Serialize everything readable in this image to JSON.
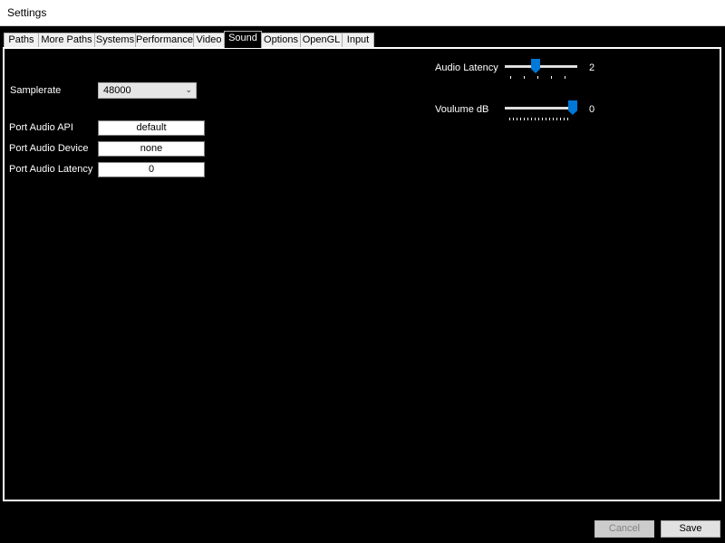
{
  "window": {
    "title": "Settings"
  },
  "tabs": [
    {
      "label": "Paths"
    },
    {
      "label": "More Paths"
    },
    {
      "label": "Systems"
    },
    {
      "label": "Performance"
    },
    {
      "label": "Video"
    },
    {
      "label": "Sound",
      "active": true
    },
    {
      "label": "Options"
    },
    {
      "label": "OpenGL"
    },
    {
      "label": "Input"
    }
  ],
  "sound": {
    "samplerate_label": "Samplerate",
    "samplerate_value": "48000",
    "port_audio_api_label": "Port Audio API",
    "port_audio_api_value": "default",
    "port_audio_device_label": "Port Audio Device",
    "port_audio_device_value": "none",
    "port_audio_latency_label": "Port Audio Latency",
    "port_audio_latency_value": "0",
    "audio_latency_label": "Audio Latency",
    "audio_latency_value": "2",
    "volume_label": "Voulume dB",
    "volume_value": "0"
  },
  "buttons": {
    "cancel": "Cancel",
    "save": "Save"
  },
  "colors": {
    "accent": "#0078d7",
    "background": "#000000"
  }
}
